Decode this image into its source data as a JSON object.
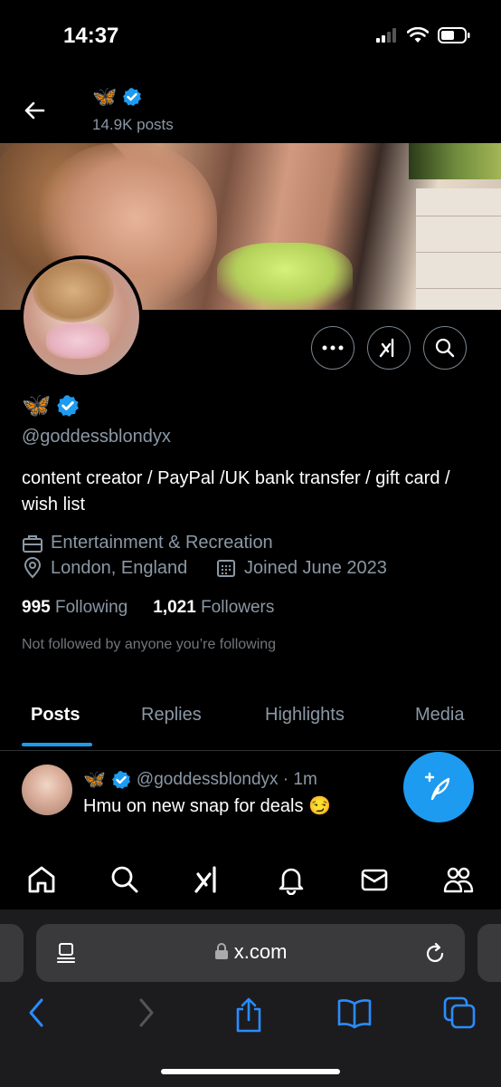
{
  "status_bar": {
    "time": "14:37"
  },
  "header": {
    "name_emoji": "🦋",
    "posts": "14.9K posts"
  },
  "profile": {
    "name_emoji": "🦋",
    "handle": "@goddessblondyx",
    "bio": "content creator / PayPal /UK bank transfer / gift card / wish list",
    "category": "Entertainment & Recreation",
    "location": "London, England",
    "joined": "Joined June 2023",
    "following_count": "995",
    "following_label": "Following",
    "followers_count": "1,021",
    "followers_label": "Followers",
    "not_followed": "Not followed by anyone you’re following"
  },
  "tabs": [
    {
      "label": "Posts",
      "active": true
    },
    {
      "label": "Replies"
    },
    {
      "label": "Highlights"
    },
    {
      "label": "Media"
    }
  ],
  "post": {
    "name_emoji": "🦋",
    "handle_time": "@goddessblondyx · 1m",
    "text": "Hmu on new snap for deals 😏"
  },
  "browser": {
    "url": "x.com"
  },
  "colors": {
    "accent": "#1d9bf0",
    "background": "#000000",
    "muted": "#8b98a5"
  }
}
